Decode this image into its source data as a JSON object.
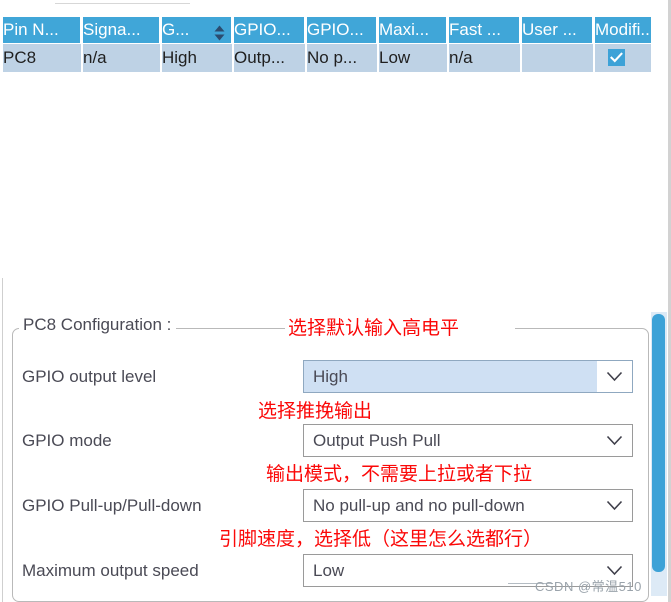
{
  "pin_table": {
    "columns": [
      {
        "label": "Pin N...",
        "sort_indicator": false
      },
      {
        "label": "Signa...",
        "sort_indicator": false
      },
      {
        "label": "G...",
        "sort_indicator": true
      },
      {
        "label": "GPIO...",
        "sort_indicator": false
      },
      {
        "label": "GPIO...",
        "sort_indicator": false
      },
      {
        "label": "Maxi...",
        "sort_indicator": false
      },
      {
        "label": "Fast ...",
        "sort_indicator": false
      },
      {
        "label": "User ...",
        "sort_indicator": false
      },
      {
        "label": "Modifi...",
        "sort_indicator": false
      }
    ],
    "rows": [
      {
        "cells": [
          "PC8",
          "n/a",
          "High",
          "Outp...",
          "No p...",
          "Low",
          "n/a",
          ""
        ],
        "modified_checked": true
      }
    ]
  },
  "config_panel": {
    "title": "PC8 Configuration :",
    "fields": [
      {
        "label": "GPIO output level",
        "value": "High",
        "selected": true
      },
      {
        "label": "GPIO mode",
        "value": "Output Push Pull",
        "selected": false
      },
      {
        "label": "GPIO Pull-up/Pull-down",
        "value": "No pull-up and no pull-down",
        "selected": false
      },
      {
        "label": "Maximum output speed",
        "value": "Low",
        "selected": false
      }
    ]
  },
  "annotations": [
    {
      "text": "选择默认输入高电平"
    },
    {
      "text": "选择推挽输出"
    },
    {
      "text": "输出模式，不需要上拉或者下拉"
    },
    {
      "text": "引脚速度，选择低（这里怎么选都行）"
    }
  ],
  "watermark": {
    "text": "CSDN @常温510"
  },
  "colors": {
    "header_blue": "#40a6d8",
    "row_blue": "#bed2e5",
    "accent": "#3da2d7",
    "annotation_red": "#fb0808",
    "label_gray": "#4a4a55"
  }
}
